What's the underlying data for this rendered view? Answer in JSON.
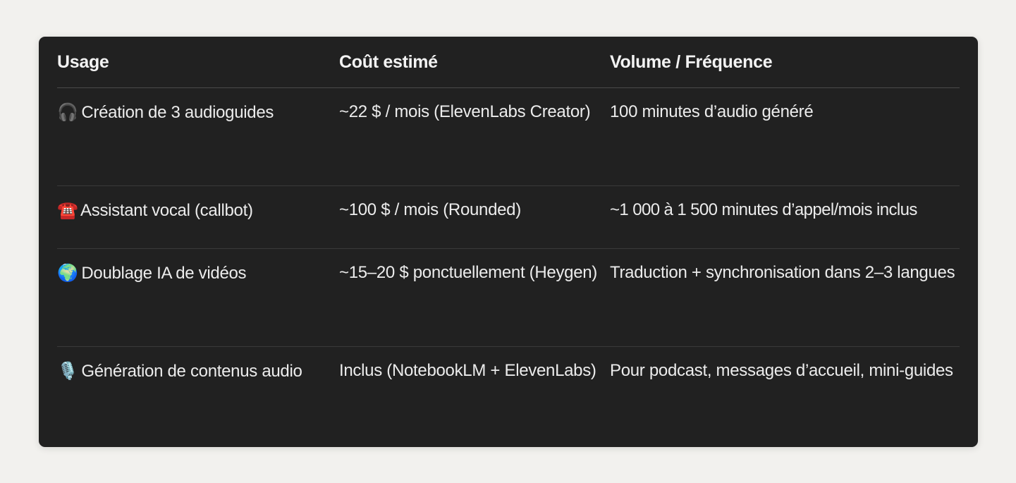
{
  "table": {
    "headers": [
      "Usage",
      "Coût estimé",
      "Volume / Fréquence"
    ],
    "rows": [
      {
        "icon": "🎧",
        "icon_name": "headphones-icon",
        "usage": "Création de 3 audioguides",
        "cost": "~22 $ / mois (ElevenLabs Creator)",
        "volume": "100 minutes d’audio généré"
      },
      {
        "icon": "☎️",
        "icon_name": "telephone-icon",
        "usage": "Assistant vocal (callbot)",
        "cost": "~100 $ / mois (Rounded)",
        "volume": "~1 000 à 1 500 minutes d’appel/mois inclus"
      },
      {
        "icon": "🌍",
        "icon_name": "globe-icon",
        "usage": "Doublage IA de vidéos",
        "cost": "~15–20 $ ponctuellement (Heygen)",
        "volume": "Traduction + synchronisation dans 2–3 langues"
      },
      {
        "icon": "🎙️",
        "icon_name": "microphone-icon",
        "usage": "Génération de contenus audio",
        "cost": "Inclus (NotebookLM + ElevenLabs)",
        "volume": "Pour podcast, messages d’accueil, mini-guides"
      }
    ]
  }
}
